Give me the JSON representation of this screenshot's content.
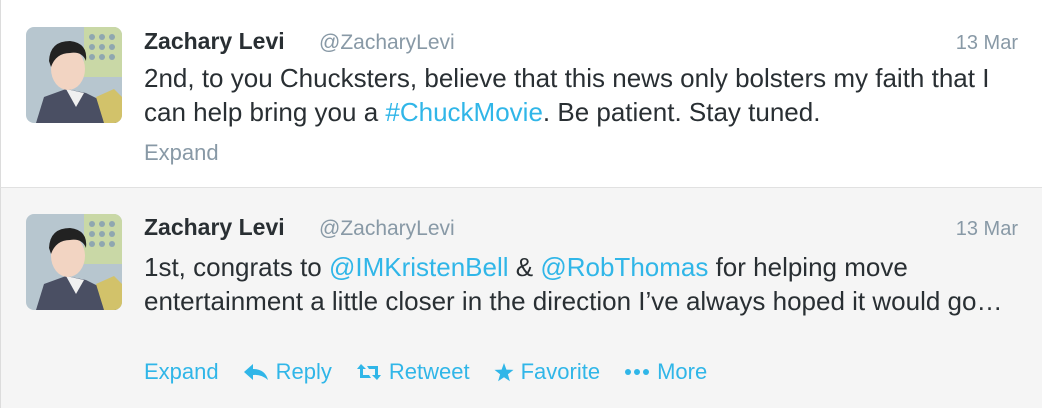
{
  "tweets": [
    {
      "author": "Zachary Levi",
      "handle": "@ZacharyLevi",
      "time": "13 Mar",
      "text_parts": [
        "2nd, to you Chucksters, believe that this news only bolsters my faith that I can help bring you a ",
        "#ChuckMovie",
        ". Be patient. Stay tuned."
      ],
      "expand": "Expand"
    },
    {
      "author": "Zachary Levi",
      "handle": "@ZacharyLevi",
      "time": "13 Mar",
      "text_parts": [
        "1st, congrats to ",
        "@IMKristenBell",
        " & ",
        "@RobThomas",
        " for helping move entertainment a little closer in the direction I’ve always hoped it would go…"
      ],
      "actions": {
        "expand": "Expand",
        "reply": "Reply",
        "retweet": "Retweet",
        "favorite": "Favorite",
        "more": "More"
      }
    }
  ],
  "icons": {
    "reply": "reply-arrow-icon",
    "retweet": "retweet-icon",
    "favorite": "star-icon",
    "more": "ellipsis-icon"
  },
  "colors": {
    "link": "#30b6e8",
    "name": "#292f33",
    "meta": "#8899a6",
    "selected_bg": "#f5f5f5"
  }
}
